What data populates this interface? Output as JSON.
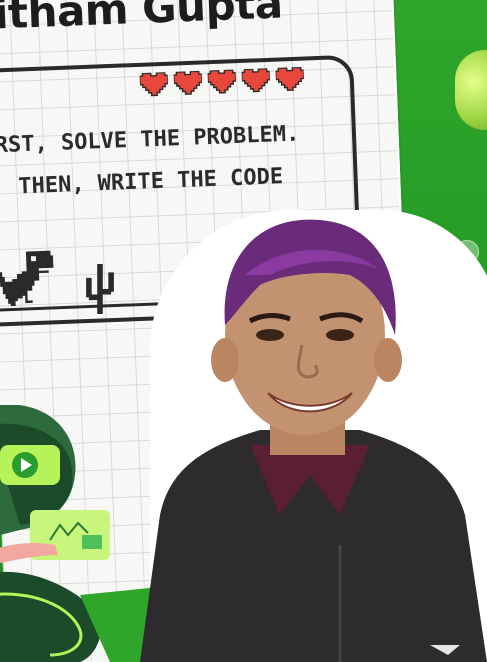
{
  "title": "itham Gupta",
  "message_lines": [
    "RST, SOLVE THE PROBLEM.",
    "THEN, WRITE THE CODE"
  ],
  "hearts_count": 5,
  "colors": {
    "green_background": "#2fa52a",
    "heart": "#e8473c",
    "ink": "#2a2a2a",
    "sheet": "#f7f7f5"
  },
  "icons": [
    "heart-icon",
    "dino-icon",
    "cactus-icon",
    "play-icon"
  ]
}
